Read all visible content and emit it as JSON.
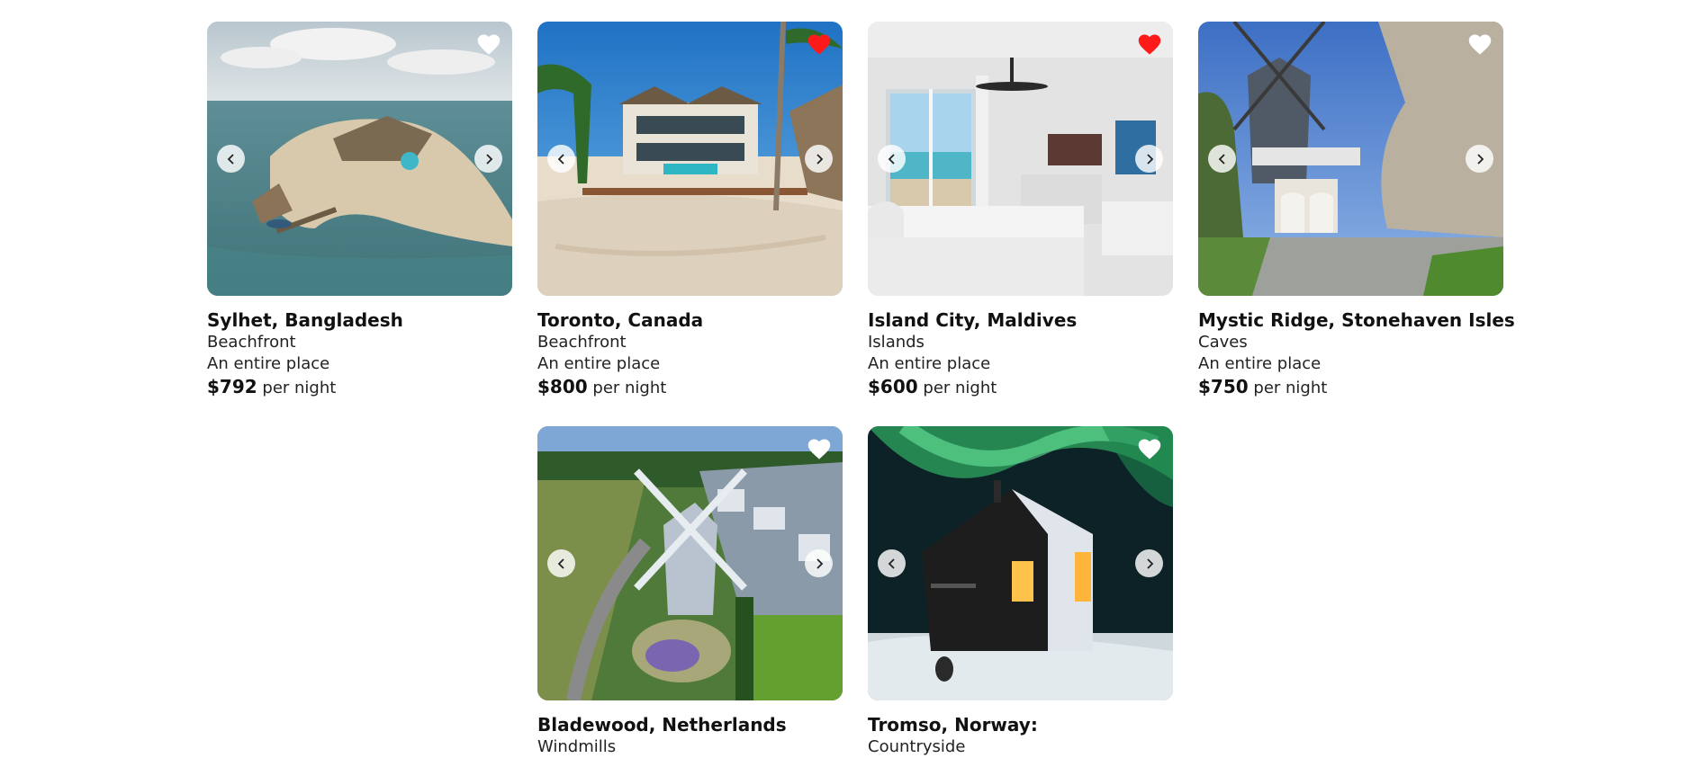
{
  "listings": [
    {
      "title": "Sylhet, Bangladesh",
      "category": "Beachfront",
      "type": "An entire place",
      "price": "$792",
      "price_suffix": " per night",
      "favorited": false,
      "image_alt": "island resort aerial"
    },
    {
      "title": "Toronto, Canada",
      "category": "Beachfront",
      "type": "An entire place",
      "price": "$800",
      "price_suffix": " per night",
      "favorited": true,
      "image_alt": "beach villa with palms"
    },
    {
      "title": "Island City, Maldives",
      "category": "Islands",
      "type": "An entire place",
      "price": "$600",
      "price_suffix": " per night",
      "favorited": true,
      "image_alt": "ocean view bedroom"
    },
    {
      "title": "Mystic Ridge, Stonehaven Isles",
      "category": "Caves",
      "type": "An entire place",
      "price": "$750",
      "price_suffix": " per night",
      "favorited": false,
      "image_alt": "windmill house"
    },
    {
      "title": "Bladewood, Netherlands",
      "category": "Windmills",
      "favorited": false,
      "image_alt": "windmill estate aerial"
    },
    {
      "title": "Tromso, Norway:",
      "category": "Countryside",
      "favorited": false,
      "image_alt": "cabin under northern lights"
    }
  ],
  "icons": {
    "favorite": "heart-icon",
    "prev": "chevron-left-icon",
    "next": "chevron-right-icon"
  },
  "colors": {
    "favorite_active": "#ff1a1a",
    "favorite_inactive": "#ffffff"
  }
}
